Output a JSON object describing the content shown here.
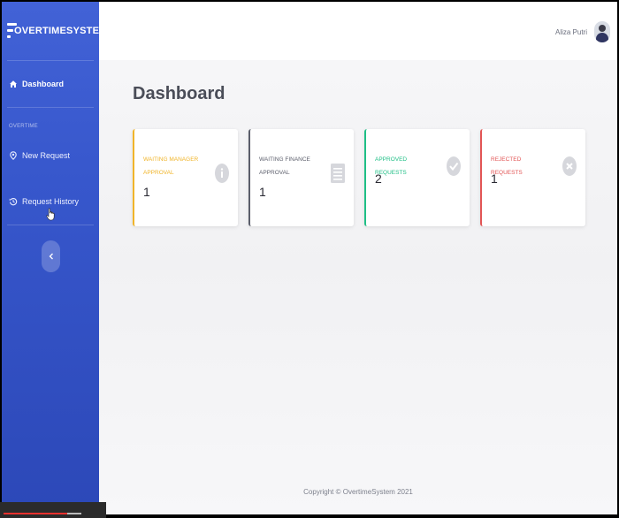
{
  "brand": {
    "title": "OVERTIMESYSTEM",
    "icon": "menu-icon"
  },
  "sidebar": {
    "items": [
      {
        "label": "Dashboard",
        "icon": "home-icon",
        "active": true
      },
      {
        "label": "New Request",
        "icon": "pin-icon"
      },
      {
        "label": "Request History",
        "icon": "history-icon"
      }
    ],
    "section": "OVERTIME",
    "toggle_icon": "chevron-left-icon"
  },
  "topbar": {
    "user_name": "Aliza Putri"
  },
  "page": {
    "title": "Dashboard"
  },
  "cards": [
    {
      "label": "WAITING MANAGER APPROVAL",
      "value": "1",
      "color": "#f0b429",
      "icon": "info-icon"
    },
    {
      "label": "WAITING FINANCE APPROVAL",
      "value": "1",
      "color": "#5b5e6b",
      "icon": "document-icon"
    },
    {
      "label": "APPROVED REQUESTS",
      "value": "2",
      "color": "#1fbf86",
      "icon": "check-icon"
    },
    {
      "label": "REJECTED REQUESTS",
      "value": "1",
      "color": "#e25555",
      "icon": "close-icon"
    }
  ],
  "footer": {
    "copyright": "Copyright © OvertimeSystem 2021"
  },
  "video_progress": 0.75
}
